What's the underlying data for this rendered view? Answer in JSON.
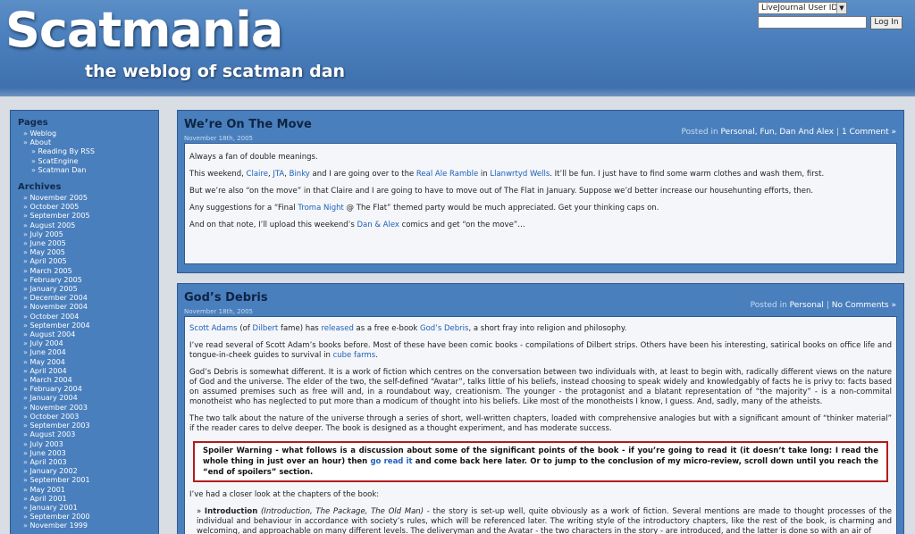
{
  "header": {
    "title": "Scatmania",
    "tagline": "the weblog of scatman dan"
  },
  "login": {
    "select_value": "LiveJournal User ID",
    "button_label": "Log In"
  },
  "sidebar": {
    "pages_heading": "Pages",
    "pages": [
      {
        "label": "Weblog",
        "sub": false
      },
      {
        "label": "About",
        "sub": false
      },
      {
        "label": "Reading By RSS",
        "sub": true
      },
      {
        "label": "ScatEngine",
        "sub": true
      },
      {
        "label": "Scatman Dan",
        "sub": true
      }
    ],
    "archives_heading": "Archives",
    "archives": [
      "November 2005",
      "October 2005",
      "September 2005",
      "August 2005",
      "July 2005",
      "June 2005",
      "May 2005",
      "April 2005",
      "March 2005",
      "February 2005",
      "January 2005",
      "December 2004",
      "November 2004",
      "October 2004",
      "September 2004",
      "August 2004",
      "July 2004",
      "June 2004",
      "May 2004",
      "April 2004",
      "March 2004",
      "February 2004",
      "January 2004",
      "November 2003",
      "October 2003",
      "September 2003",
      "August 2003",
      "July 2003",
      "June 2003",
      "April 2003",
      "January 2002",
      "September 2001",
      "May 2001",
      "April 2001",
      "January 2001",
      "September 2000",
      "November 1999"
    ]
  },
  "post1": {
    "title": "We’re On The Move",
    "date": "November 18th, 2005",
    "posted_in": "Posted in",
    "categories": "Personal, Fun, Dan And Alex",
    "sep": "|",
    "comments": "1 Comment »",
    "p1": "Always a fan of double meanings.",
    "p2_a": "This weekend, ",
    "p2_l1": "Claire",
    "p2_c1": ", ",
    "p2_l2": "JTA",
    "p2_c2": ", ",
    "p2_l3": "Binky",
    "p2_b": " and I are going over to the ",
    "p2_l4": "Real Ale Ramble",
    "p2_c": " in ",
    "p2_l5": "Llanwrtyd Wells",
    "p2_d": ". It’ll be fun. I just have to find some warm clothes and wash them, first.",
    "p3": "But we’re also “on the move” in that Claire and I are going to have to move out of The Flat in January. Suppose we’d better increase our househunting efforts, then.",
    "p4_a": "Any suggestions for a “Final ",
    "p4_l": "Troma Night",
    "p4_b": " @ The Flat” themed party would be much appreciated. Get your thinking caps on.",
    "p5_a": "And on that note, I’ll upload this weekend’s ",
    "p5_l": "Dan & Alex",
    "p5_b": " comics and get “on the move”…"
  },
  "post2": {
    "title": "God’s Debris",
    "date": "November 18th, 2005",
    "posted_in": "Posted in",
    "categories": "Personal",
    "sep": "|",
    "comments": "No Comments »",
    "p1_l1": "Scott Adams",
    "p1_a": " (of ",
    "p1_l2": "Dilbert",
    "p1_b": " fame) has ",
    "p1_l3": "released",
    "p1_c": " as a free e-book ",
    "p1_l4": "God’s Debris",
    "p1_d": ", a short fray into religion and philosophy.",
    "p2_a": "I’ve read several of Scott Adam’s books before. Most of these have been comic books - compilations of Dilbert strips. Others have been his interesting, satirical books on office life and tongue-in-cheek guides to survival in ",
    "p2_l": "cube farms",
    "p2_b": ".",
    "p3": "God’s Debris is somewhat different. It is a work of fiction which centres on the conversation between two individuals with, at least to begin with, radically different views on the nature of God and the universe. The elder of the two, the self-defined “Avatar”, talks little of his beliefs, instead choosing to speak widely and knowledgably of facts he is privy to: facts based on assumed premises such as free will and, in a roundabout way, creationism. The younger - the protagonist and a blatant representation of “the majority” - is a non-commital monotheist who has neglected to put more than a modicum of thought into his beliefs. Like most of the monotheists I know, I guess. And, sadly, many of the atheists.",
    "p4": "The two talk about the nature of the universe through a series of short, well-written chapters, loaded with comprehensive analogies but with a significant amount of “thinker material” if the reader cares to delve deeper. The book is designed as a thought experiment, and has moderate success.",
    "spoiler_a": "Spoiler Warning - what follows is a discussion about some of the significant points of the book - if you’re going to read it (it doesn’t take long: I read the whole thing in just over an hour) then ",
    "spoiler_l": "go read it",
    "spoiler_b": " and come back here later. Or to jump to the conclusion of my micro-review, scroll down until you reach the “end of spoilers” section.",
    "p5": "I’ve had a closer look at the chapters of the book:",
    "ch1_title": "Introduction",
    "ch1_sub": " (Introduction, The Package, The Old Man)",
    "ch1_text": " - the story is set-up well, quite obviously as a work of fiction. Several mentions are made to thought processes of the individual and behaviour in accordance with society’s rules, which will be referenced later. The writing style of the introductory chapters, like the rest of the book, is charming and welcoming, and approachable on many different levels. The deliveryman and the Avatar - the two characters in the story - are introduced, and the latter is done so with an air of"
  }
}
